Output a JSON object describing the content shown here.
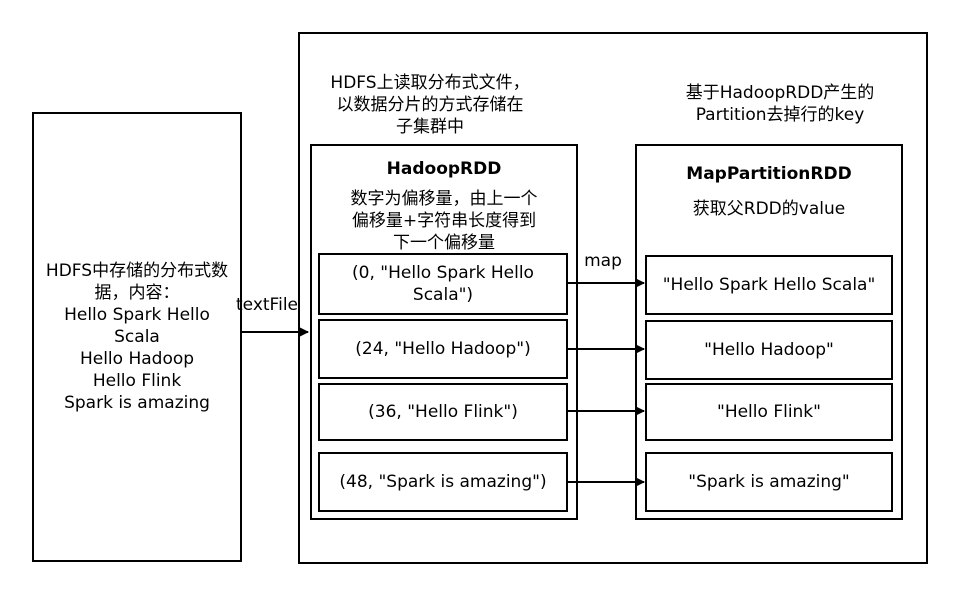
{
  "source": {
    "lines": [
      "HDFS中存储的分布式数",
      "据，内容：",
      "Hello Spark Hello Scala",
      "Hello Hadoop",
      "Hello Flink",
      "Spark is amazing"
    ]
  },
  "edge_textfile": "textFile",
  "edge_map": "map",
  "hadoop_caption": [
    "HDFS上读取分布式文件，",
    "以数据分片的方式存储在",
    "子集群中"
  ],
  "map_caption": [
    "基于HadoopRDD产生的",
    "Partition去掉行的key"
  ],
  "hadoop_rdd": {
    "title": "HadoopRDD",
    "desc": [
      "数字为偏移量，由上一个",
      "偏移量+字符串长度得到",
      "下一个偏移量"
    ],
    "partitions": [
      "(0, \"Hello Spark Hello Scala\")",
      "(24, \"Hello Hadoop\")",
      "(36, \"Hello Flink\")",
      "(48, \"Spark is amazing\")"
    ]
  },
  "map_rdd": {
    "title": "MapPartitionRDD",
    "desc": "获取父RDD的value",
    "partitions": [
      "\"Hello Spark Hello Scala\"",
      "\"Hello Hadoop\"",
      "\"Hello Flink\"",
      "\"Spark is amazing\""
    ]
  }
}
